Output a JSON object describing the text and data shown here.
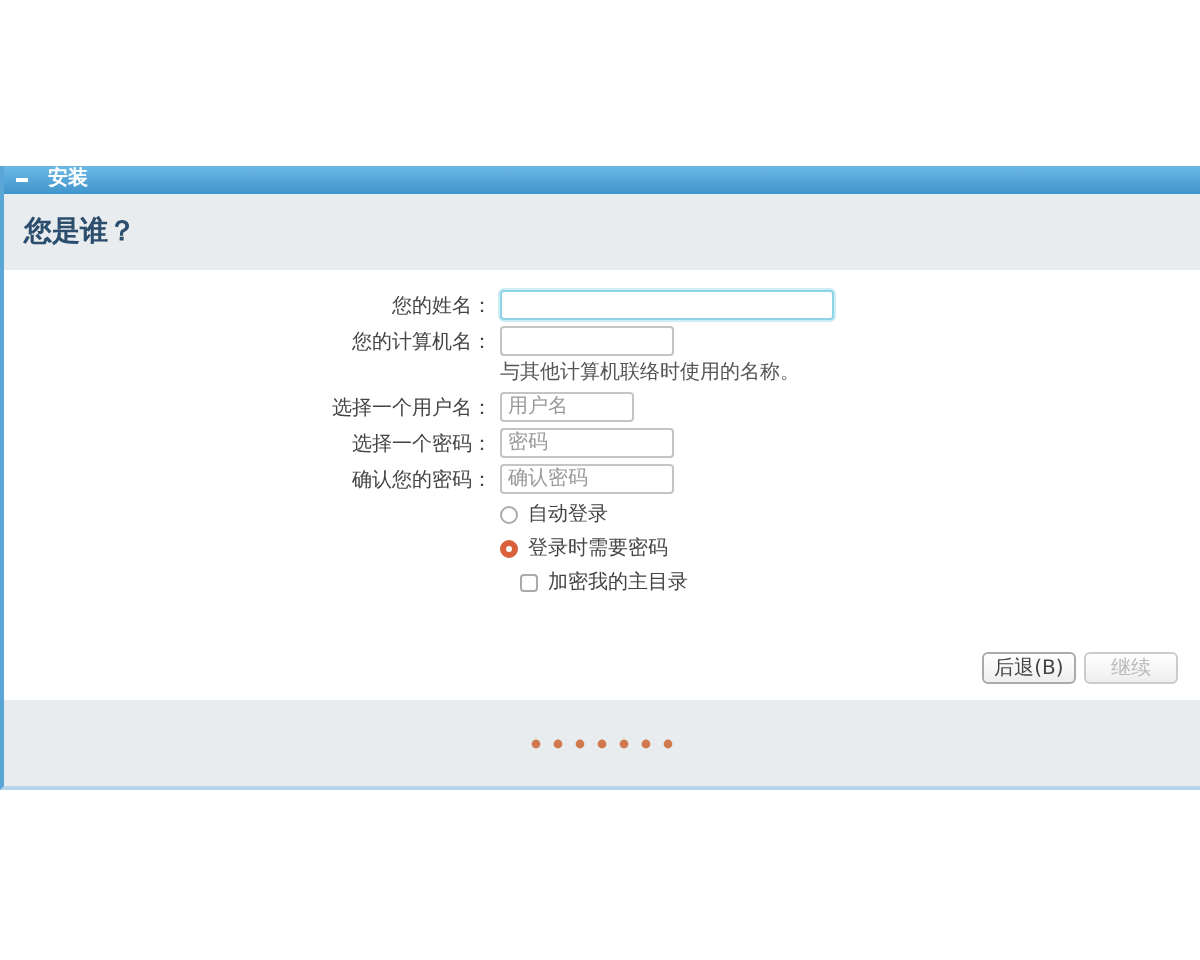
{
  "window": {
    "title": "安装"
  },
  "header": {
    "title": "您是谁？"
  },
  "fields": [
    {
      "label": "您的姓名：",
      "focused": true
    },
    {
      "label": "您的计算机名：",
      "focused": false,
      "hint": "与其他计算机联络时使用的名称。"
    },
    {
      "label": "选择一个用户名：",
      "placeholder": "用户名",
      "focused": false
    },
    {
      "label": "选择一个密码：",
      "placeholder": "密码",
      "focused": false
    },
    {
      "label": "确认您的密码：",
      "placeholder": "确认密码",
      "focused": false
    }
  ],
  "login_options": [
    {
      "kind": "radio",
      "label": "自动登录",
      "selected": false
    },
    {
      "kind": "radio",
      "label": "登录时需要密码",
      "selected": true
    },
    {
      "kind": "checkbox",
      "label": "加密我的主目录",
      "checked": false
    }
  ],
  "buttons": [
    {
      "label": "后退(B)",
      "disabled": false
    },
    {
      "label": "继续",
      "disabled": true
    }
  ]
}
